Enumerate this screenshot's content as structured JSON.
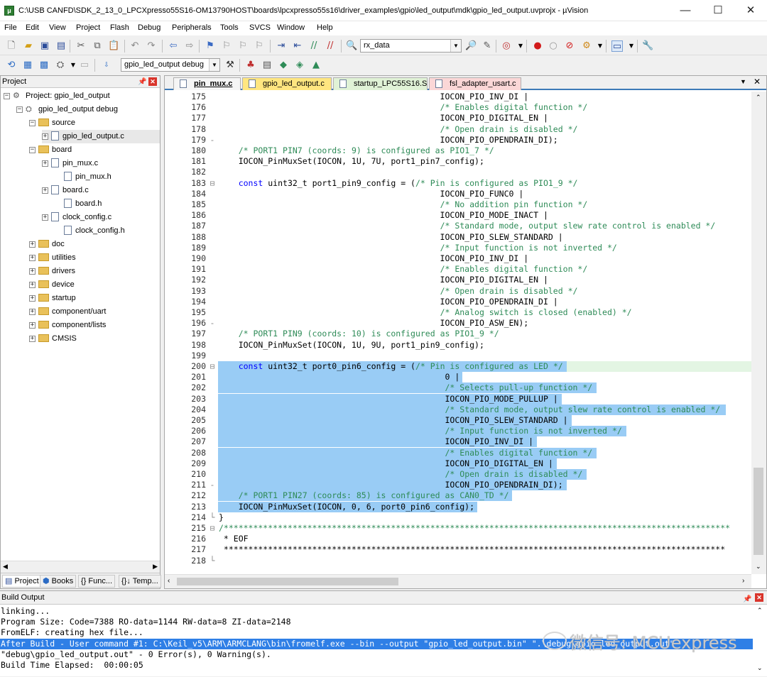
{
  "window": {
    "title": "C:\\USB CANFD\\SDK_2_13_0_LPCXpresso55S16-OM13790HOST\\boards\\lpcxpresso55s16\\driver_examples\\gpio\\led_output\\mdk\\gpio_led_output.uvprojx - µVision",
    "minimize": "—",
    "maximize": "☐",
    "close": "✕"
  },
  "menu": [
    "File",
    "Edit",
    "View",
    "Project",
    "Flash",
    "Debug",
    "Peripherals",
    "Tools",
    "SVCS",
    "Window",
    "Help"
  ],
  "toolbar": {
    "find_combo": "rx_data",
    "target_combo": "gpio_led_output debug"
  },
  "project_panel": {
    "title": "Project",
    "pin": "ᵖ",
    "close": "✕",
    "tree": [
      {
        "label": "Project: gpio_led_output",
        "kind": "project",
        "expander": "−"
      },
      {
        "label": "gpio_led_output debug",
        "kind": "target",
        "expander": "−"
      },
      {
        "label": "source",
        "kind": "folder",
        "expander": "−"
      },
      {
        "label": "gpio_led_output.c",
        "kind": "file",
        "expander": "+"
      },
      {
        "label": "board",
        "kind": "folder",
        "expander": "−"
      },
      {
        "label": "pin_mux.c",
        "kind": "file",
        "expander": "+"
      },
      {
        "label": "pin_mux.h",
        "kind": "file",
        "expander": ""
      },
      {
        "label": "board.c",
        "kind": "file",
        "expander": "+"
      },
      {
        "label": "board.h",
        "kind": "file",
        "expander": ""
      },
      {
        "label": "clock_config.c",
        "kind": "file",
        "expander": "+"
      },
      {
        "label": "clock_config.h",
        "kind": "file",
        "expander": ""
      },
      {
        "label": "doc",
        "kind": "folder",
        "expander": "+"
      },
      {
        "label": "utilities",
        "kind": "folder",
        "expander": "+"
      },
      {
        "label": "drivers",
        "kind": "folder",
        "expander": "+"
      },
      {
        "label": "device",
        "kind": "folder",
        "expander": "+"
      },
      {
        "label": "startup",
        "kind": "folder",
        "expander": "+"
      },
      {
        "label": "component/uart",
        "kind": "folder",
        "expander": "+"
      },
      {
        "label": "component/lists",
        "kind": "folder",
        "expander": "+"
      },
      {
        "label": "CMSIS",
        "kind": "folder",
        "expander": "+"
      }
    ],
    "tabs": [
      "Project",
      "Books",
      "{} Func...",
      "{}↓ Temp..."
    ]
  },
  "editor": {
    "tabs": [
      "pin_mux.c",
      "gpio_led_output.c",
      "startup_LPC55S16.S",
      "fsl_adapter_usart.c"
    ],
    "active_tab": 0,
    "tab_colors": [
      "#f5f5f5",
      "#ffe680",
      "#e0f2d6",
      "#fbd7d7"
    ],
    "lines": [
      {
        "n": "175",
        "f": "",
        "t": "                                             IOCON_PIO_INV_DI |",
        "s": 0
      },
      {
        "n": "176",
        "f": "",
        "t": "                                             /* Enables digital function */",
        "s": 0
      },
      {
        "n": "177",
        "f": "",
        "t": "                                             IOCON_PIO_DIGITAL_EN |",
        "s": 0
      },
      {
        "n": "178",
        "f": "",
        "t": "                                             /* Open drain is disabled */",
        "s": 0
      },
      {
        "n": "179",
        "f": "-",
        "t": "                                             IOCON_PIO_OPENDRAIN_DI);",
        "s": 0
      },
      {
        "n": "180",
        "f": "",
        "t": "    /* PORT1 PIN7 (coords: 9) is configured as PIO1_7 */",
        "s": 0
      },
      {
        "n": "181",
        "f": "",
        "t": "    IOCON_PinMuxSet(IOCON, 1U, 7U, port1_pin7_config);",
        "s": 0
      },
      {
        "n": "182",
        "f": "",
        "t": "",
        "s": 0
      },
      {
        "n": "183",
        "f": "⊟",
        "t": "    const uint32_t port1_pin9_config = (/* Pin is configured as PIO1_9 */",
        "s": 0
      },
      {
        "n": "184",
        "f": "",
        "t": "                                             IOCON_PIO_FUNC0 |",
        "s": 0
      },
      {
        "n": "185",
        "f": "",
        "t": "                                             /* No addition pin function */",
        "s": 0
      },
      {
        "n": "186",
        "f": "",
        "t": "                                             IOCON_PIO_MODE_INACT |",
        "s": 0
      },
      {
        "n": "187",
        "f": "",
        "t": "                                             /* Standard mode, output slew rate control is enabled */",
        "s": 0
      },
      {
        "n": "188",
        "f": "",
        "t": "                                             IOCON_PIO_SLEW_STANDARD |",
        "s": 0
      },
      {
        "n": "189",
        "f": "",
        "t": "                                             /* Input function is not inverted */",
        "s": 0
      },
      {
        "n": "190",
        "f": "",
        "t": "                                             IOCON_PIO_INV_DI |",
        "s": 0
      },
      {
        "n": "191",
        "f": "",
        "t": "                                             /* Enables digital function */",
        "s": 0
      },
      {
        "n": "192",
        "f": "",
        "t": "                                             IOCON_PIO_DIGITAL_EN |",
        "s": 0
      },
      {
        "n": "193",
        "f": "",
        "t": "                                             /* Open drain is disabled */",
        "s": 0
      },
      {
        "n": "194",
        "f": "",
        "t": "                                             IOCON_PIO_OPENDRAIN_DI |",
        "s": 0
      },
      {
        "n": "195",
        "f": "",
        "t": "                                             /* Analog switch is closed (enabled) */",
        "s": 0
      },
      {
        "n": "196",
        "f": "-",
        "t": "                                             IOCON_PIO_ASW_EN);",
        "s": 0
      },
      {
        "n": "197",
        "f": "",
        "t": "    /* PORT1 PIN9 (coords: 10) is configured as PIO1_9 */",
        "s": 0
      },
      {
        "n": "198",
        "f": "",
        "t": "    IOCON_PinMuxSet(IOCON, 1U, 9U, port1_pin9_config);",
        "s": 0
      },
      {
        "n": "199",
        "f": "",
        "t": "",
        "s": 0
      },
      {
        "n": "200",
        "f": "⊟",
        "t": "    const uint32_t port0_pin6_config = (/* Pin is configured as LED */",
        "s": 1
      },
      {
        "n": "201",
        "f": "",
        "t": "                                              0 |",
        "s": 1
      },
      {
        "n": "202",
        "f": "",
        "t": "                                              /* Selects pull-up function */",
        "s": 1
      },
      {
        "n": "203",
        "f": "",
        "t": "                                              IOCON_PIO_MODE_PULLUP |",
        "s": 1
      },
      {
        "n": "204",
        "f": "",
        "t": "                                              /* Standard mode, output slew rate control is enabled */",
        "s": 1
      },
      {
        "n": "205",
        "f": "",
        "t": "                                              IOCON_PIO_SLEW_STANDARD |",
        "s": 1
      },
      {
        "n": "206",
        "f": "",
        "t": "                                              /* Input function is not inverted */",
        "s": 1
      },
      {
        "n": "207",
        "f": "",
        "t": "                                              IOCON_PIO_INV_DI |",
        "s": 1
      },
      {
        "n": "208",
        "f": "",
        "t": "                                              /* Enables digital function */",
        "s": 1
      },
      {
        "n": "209",
        "f": "",
        "t": "                                              IOCON_PIO_DIGITAL_EN |",
        "s": 1
      },
      {
        "n": "210",
        "f": "",
        "t": "                                              /* Open drain is disabled */",
        "s": 1
      },
      {
        "n": "211",
        "f": "-",
        "t": "                                              IOCON_PIO_OPENDRAIN_DI);",
        "s": 1
      },
      {
        "n": "212",
        "f": "",
        "t": "    /* PORT1 PIN27 (coords: 85) is configured as CAN0_TD */",
        "s": 1
      },
      {
        "n": "213",
        "f": "",
        "t": "    IOCON_PinMuxSet(IOCON, 0, 6, port0_pin6_config);",
        "s": 1
      },
      {
        "n": "214",
        "f": "└",
        "t": "}",
        "s": 0
      },
      {
        "n": "215",
        "f": "⊟",
        "t": "/*******************************************************************************************************",
        "s": 0
      },
      {
        "n": "216",
        "f": "",
        "t": " * EOF",
        "s": 0
      },
      {
        "n": "217",
        "f": "",
        "t": " ******************************************************************************************************",
        "s": 0
      },
      {
        "n": "218",
        "f": "└",
        "t": "",
        "s": 0
      }
    ]
  },
  "build_output": {
    "title": "Build Output",
    "lines": [
      {
        "t": "linking...",
        "s": 0
      },
      {
        "t": "Program Size: Code=7388 RO-data=1144 RW-data=8 ZI-data=2148",
        "s": 0
      },
      {
        "t": "FromELF: creating hex file...",
        "s": 0
      },
      {
        "t": "After Build - User command #1: C:\\Keil_v5\\ARM\\ARMCLANG\\bin\\fromelf.exe --bin --output \"gpio_led_output.bin\" \".\\debug\\gpio_led_output.out\"",
        "s": 1
      },
      {
        "t": "\"debug\\gpio_led_output.out\" - 0 Error(s), 0 Warning(s).",
        "s": 0
      },
      {
        "t": "Build Time Elapsed:  00:00:05",
        "s": 0
      }
    ]
  },
  "watermark": "微信号: MCUexpress"
}
